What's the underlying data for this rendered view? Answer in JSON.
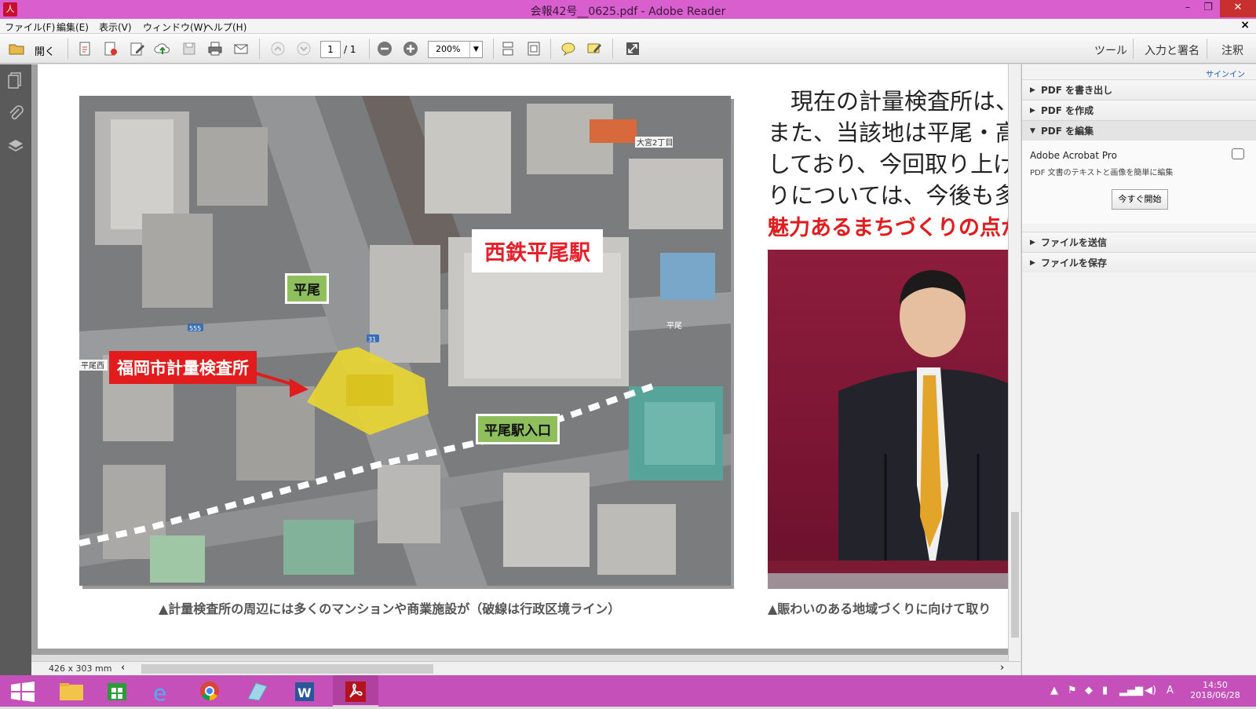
{
  "window": {
    "title": "会報42号__0625.pdf - Adobe Reader",
    "app_icon": "pdf-icon",
    "minimize": "–",
    "maximize": "❐",
    "close": "✕"
  },
  "menu": {
    "items": [
      "ファイル(F)",
      "編集(E)",
      "表示(V)",
      "ウィンドウ(W)",
      "ヘルプ(H)"
    ],
    "doc_close": "×"
  },
  "toolbar": {
    "open_label": "開く",
    "page_current": "1",
    "page_total": "/ 1",
    "zoom": "200%",
    "tools": "ツール",
    "fill_sign": "入力と署名",
    "comment": "注釈"
  },
  "document": {
    "aerial": {
      "labels": {
        "station": "西鉄平尾駅",
        "hirao": "平尾",
        "entrance": "平尾駅入口",
        "facility": "福岡市計量検査所",
        "map_tag_top": "大宮2丁目",
        "map_tag_left": "平尾西",
        "map_tag_right": "平尾",
        "route_555": "555",
        "route_31": "31"
      }
    },
    "caption_left": "▲計量検査所の周辺には多くのマンションや商業施設が（破線は行政区境ライン）",
    "caption_right": "▲賑わいのある地域づくりに向けて取り",
    "body_lines": [
      "　現在の計量検査所は、",
      "また、当該地は平尾・高宮",
      "しており、今回取り上げた",
      "りについては、今後も多くの"
    ],
    "red_line": "魅力あるまちづくりの点か"
  },
  "statusbar": {
    "page_size": "426 x 303 mm",
    "scroll_left": "‹",
    "scroll_right": "›"
  },
  "right_panel": {
    "signin": "サインイン",
    "sections": [
      {
        "label": "PDF を書き出し",
        "open": false
      },
      {
        "label": "PDF を作成",
        "open": false
      },
      {
        "label": "PDF を編集",
        "open": true
      }
    ],
    "promo_title": "Adobe Acrobat Pro",
    "promo_desc": "PDF 文書のテキストと画像を簡単に編集",
    "promo_button": "今すぐ開始",
    "sections_after": [
      {
        "label": "ファイルを送信"
      },
      {
        "label": "ファイルを保存"
      }
    ]
  },
  "taskbar": {
    "apps": [
      "start-icon",
      "file-explorer-icon",
      "store-icon",
      "internet-explorer-icon",
      "chrome-icon",
      "app-icon",
      "word-icon",
      "acrobat-reader-icon"
    ],
    "ime": "A",
    "time": "14:50",
    "date": "2018/06/28"
  },
  "colors": {
    "titlebar": "#d95fcf",
    "taskbar": "#c550b9",
    "accent_red": "#e21c1c",
    "label_green": "#8fbf5d",
    "facility_yellow": "#e8d532"
  }
}
